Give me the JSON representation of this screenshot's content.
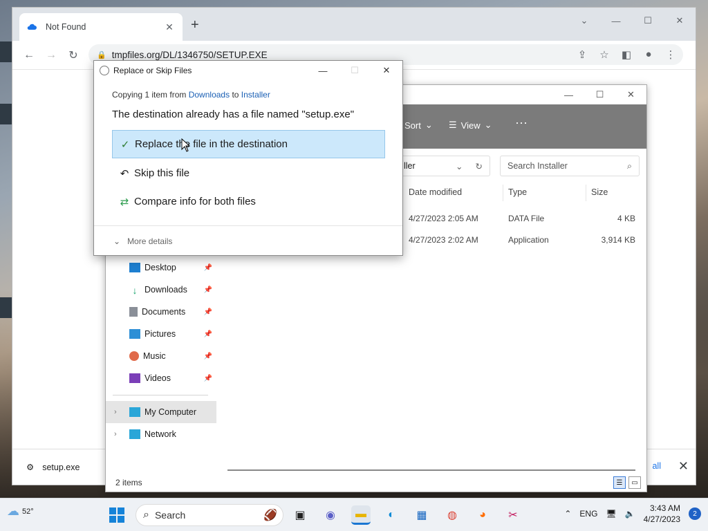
{
  "browser": {
    "tab_title": "Not Found",
    "url": "tmpfiles.org/DL/1346750/SETUP.EXE",
    "download": {
      "file_name": "setup.exe",
      "show_all": "all"
    }
  },
  "explorer": {
    "commands": {
      "sort": "Sort",
      "view": "View"
    },
    "address_fragment": "ller",
    "search_placeholder": "Search Installer",
    "columns": [
      "Date modified",
      "Type",
      "Size"
    ],
    "rows": [
      {
        "date": "4/27/2023 2:05 AM",
        "type": "DATA File",
        "size": "4 KB"
      },
      {
        "date": "4/27/2023 2:02 AM",
        "type": "Application",
        "size": "3,914 KB"
      }
    ],
    "nav": [
      {
        "label": "Desktop",
        "color": "#1e7fd0"
      },
      {
        "label": "Downloads",
        "color": "#15a36a"
      },
      {
        "label": "Documents",
        "color": "#8a8f98"
      },
      {
        "label": "Pictures",
        "color": "#2d8fd6"
      },
      {
        "label": "Music",
        "color": "#e06a4a"
      },
      {
        "label": "Videos",
        "color": "#7b3fb8"
      }
    ],
    "nav_lower": [
      {
        "label": "My Computer"
      },
      {
        "label": "Network"
      }
    ],
    "status": "2 items"
  },
  "dialog": {
    "title": "Replace or Skip Files",
    "copying_prefix": "Copying 1 item from",
    "source": "Downloads",
    "to": "to",
    "target": "Installer",
    "message": "The destination already has a file named \"setup.exe\"",
    "options": [
      "Replace the file in the destination",
      "Skip this file",
      "Compare info for both files"
    ],
    "more_details": "More details"
  },
  "taskbar": {
    "temperature": "52°",
    "search": "Search",
    "language": "ENG",
    "time": "3:43 AM",
    "date": "4/27/2023",
    "notifications": "2"
  },
  "colors": {
    "accent": "#1976d2",
    "highlight": "#cce8fb"
  }
}
